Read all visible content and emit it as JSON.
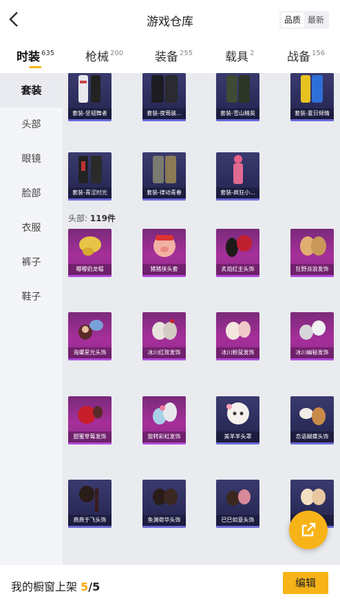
{
  "header": {
    "title": "游戏仓库",
    "sort_options": [
      "品质",
      "最新"
    ],
    "active_sort": "品质"
  },
  "tabs": [
    {
      "label": "时装",
      "count": "635",
      "active": true
    },
    {
      "label": "枪械",
      "count": "200",
      "active": false
    },
    {
      "label": "装备",
      "count": "255",
      "active": false
    },
    {
      "label": "载具",
      "count": "2",
      "active": false
    },
    {
      "label": "战备",
      "count": "156",
      "active": false
    }
  ],
  "sidebar": {
    "items": [
      {
        "label": "套装",
        "active": true
      },
      {
        "label": "头部",
        "active": false
      },
      {
        "label": "眼镜",
        "active": false
      },
      {
        "label": "脸部",
        "active": false
      },
      {
        "label": "衣服",
        "active": false
      },
      {
        "label": "裤子",
        "active": false
      },
      {
        "label": "鞋子",
        "active": false
      }
    ]
  },
  "suits": {
    "items": [
      {
        "name": "套装-坚韧舞者",
        "icon": "white-outfit-icon"
      },
      {
        "name": "套装-夜莺骇...",
        "icon": "dark-outfit-icon"
      },
      {
        "name": "套装-雪山精英",
        "icon": "camo-outfit-icon"
      },
      {
        "name": "套装-夏日倾情",
        "icon": "summer-outfit-icon"
      },
      {
        "name": "套装-青涩时光",
        "icon": "school-outfit-icon"
      },
      {
        "name": "套装-律动青春",
        "icon": "youth-outfit-icon"
      },
      {
        "name": "套装-疯狂小...",
        "icon": "pink-outfit-icon"
      }
    ]
  },
  "heads": {
    "section_prefix": "头部:",
    "section_count": "119件",
    "items": [
      {
        "name": "嘟嘟奶龙帽",
        "icon": "yellow-hat-icon"
      },
      {
        "name": "猪猪侠头套",
        "icon": "pig-mask-icon"
      },
      {
        "name": "炙焰红主头饰",
        "icon": "red-hair-icon"
      },
      {
        "name": "狂野派浪发饰",
        "icon": "wavy-hair-icon"
      },
      {
        "name": "海螺星光头饰",
        "icon": "shell-hat-icon"
      },
      {
        "name": "冰川红玫发饰",
        "icon": "rose-hair-icon"
      },
      {
        "name": "冰川粉鼠发饰",
        "icon": "pink-hair-icon"
      },
      {
        "name": "冰川幽秘发饰",
        "icon": "silver-hair-icon"
      },
      {
        "name": "甜蜜草莓发饰",
        "icon": "strawberry-hair-icon"
      },
      {
        "name": "旋转彩虹发饰",
        "icon": "rainbow-hair-icon"
      },
      {
        "name": "美羊羊头罩",
        "icon": "sheep-mask-icon"
      },
      {
        "name": "恋语蝴蝶头饰",
        "icon": "butterfly-hair-icon"
      },
      {
        "name": "燕燕于飞头饰",
        "icon": "braid-hair-icon"
      },
      {
        "name": "鱼渊荷华头饰",
        "icon": "bun-hair-icon"
      },
      {
        "name": "巳巳如意头饰",
        "icon": "pink-bun-icon"
      },
      {
        "name": "",
        "icon": "blonde-hair-icon"
      }
    ]
  },
  "footer": {
    "label": "我的橱窗上架",
    "current": "5",
    "separator": "/",
    "total": "5",
    "edit_label": "编辑"
  },
  "fab_icon": "share-icon",
  "colors": {
    "accent": "#f6b417",
    "purple_card": "#2a2a58",
    "pink_card": "#a62f9a"
  }
}
